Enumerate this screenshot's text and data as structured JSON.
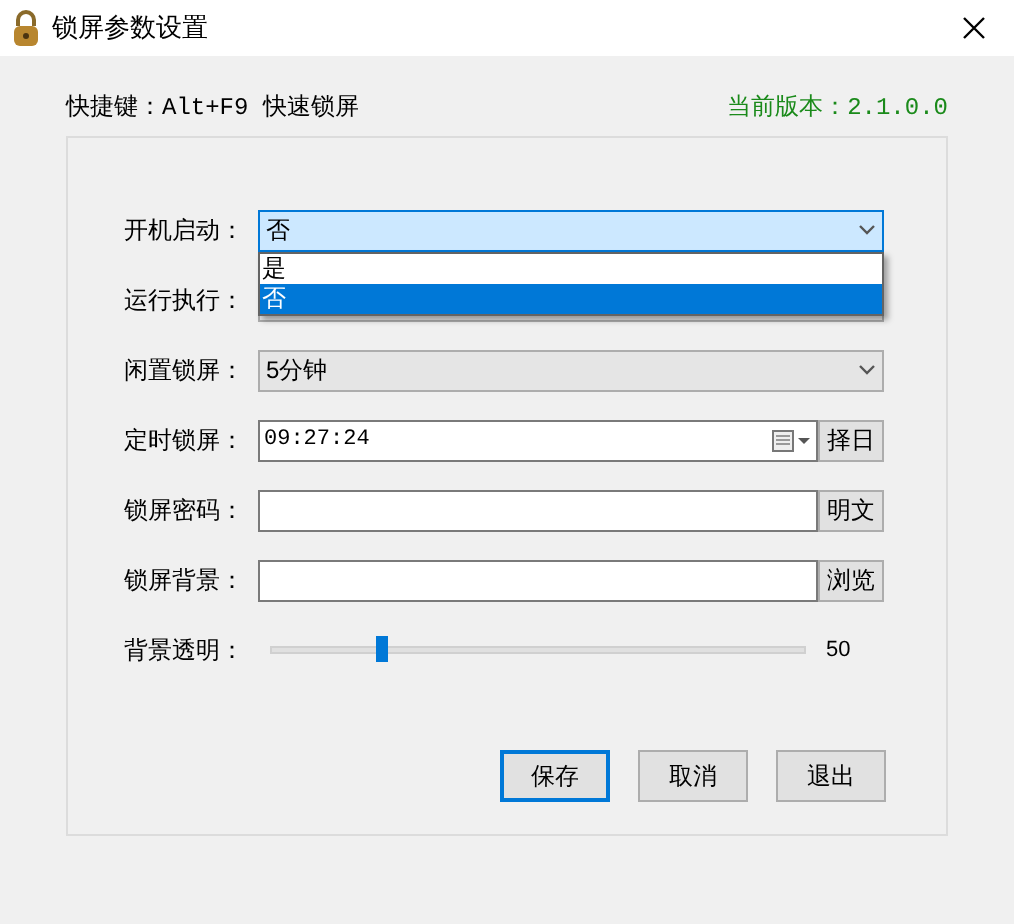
{
  "window": {
    "title": "锁屏参数设置"
  },
  "header": {
    "hotkey": "快捷键：Alt+F9 快速锁屏",
    "version": "当前版本：2.1.0.0"
  },
  "fields": [
    {
      "kind": "combo",
      "label": "开机启动：",
      "value": "否",
      "focused": true,
      "dropdown": [
        {
          "label": "是",
          "selected": false
        },
        {
          "label": "否",
          "selected": true
        }
      ]
    },
    {
      "kind": "combo",
      "label": "运行执行：",
      "focused": false
    },
    {
      "kind": "combo",
      "label": "闲置锁屏：",
      "value": "5分钟",
      "focused": false
    },
    {
      "kind": "datetime",
      "label": "定时锁屏：",
      "value": "09:27:24",
      "button": "择日"
    },
    {
      "kind": "text",
      "label": "锁屏密码：",
      "button": "明文"
    },
    {
      "kind": "text",
      "label": "锁屏背景：",
      "button": "浏览"
    },
    {
      "kind": "slider",
      "label": "背景透明：",
      "level": 0.2,
      "reading": "50"
    }
  ],
  "buttons": [
    {
      "label": "保存",
      "default": true
    },
    {
      "label": "取消",
      "default": false
    },
    {
      "label": "退出",
      "default": false
    }
  ]
}
